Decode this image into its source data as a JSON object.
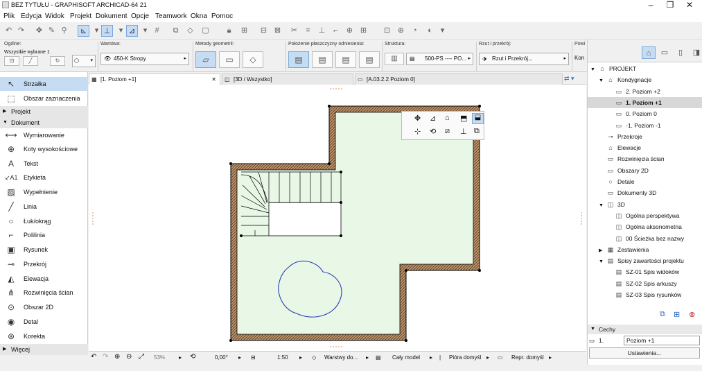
{
  "window": {
    "title": "BEZ TYTUŁU - GRAPHISOFT ARCHICAD-64 21"
  },
  "menu": [
    "Plik",
    "Edycja",
    "Widok",
    "Projekt",
    "Dokument",
    "Opcje",
    "Teamwork",
    "Okna",
    "Pomoc"
  ],
  "info": {
    "general_label": "Ogólne:",
    "general_value": "Wszystkie wybrane 1",
    "layer_label": "Warstwa:",
    "layer_value": "450-K Stropy",
    "geometry_label": "Metody geometrii:",
    "plane_label": "Położenie płaszczyzny odniesienia:",
    "structure_label": "Struktura:",
    "structure_value": "500-PS ---- PO...",
    "plan_label": "Rzut i przekrój:",
    "plan_value": "Rzut i Przekrój...",
    "extra_label": "Powi",
    "extra_value": "Kon"
  },
  "toolbox": {
    "items_top": [
      {
        "label": "Strzałka",
        "icon": "arrow-icon"
      },
      {
        "label": "Obszar zaznaczenia",
        "icon": "marquee-icon"
      }
    ],
    "section_projekt": "Projekt",
    "section_dokument": "Dokument",
    "items_doc": [
      {
        "label": "Wymiarowanie",
        "icon": "dimension-icon"
      },
      {
        "label": "Koty wysokościowe",
        "icon": "level-icon"
      },
      {
        "label": "Tekst",
        "icon": "text-icon"
      },
      {
        "label": "Etykieta",
        "icon": "label-icon"
      },
      {
        "label": "Wypełnienie",
        "icon": "fill-icon"
      },
      {
        "label": "Linia",
        "icon": "line-icon"
      },
      {
        "label": "Łuk/okrąg",
        "icon": "arc-icon"
      },
      {
        "label": "Polilinia",
        "icon": "polyline-icon"
      },
      {
        "label": "Rysunek",
        "icon": "drawing-icon"
      },
      {
        "label": "Przekrój",
        "icon": "section-icon"
      },
      {
        "label": "Elewacja",
        "icon": "elevation-icon"
      },
      {
        "label": "Rozwinięcia ścian",
        "icon": "interior-elevation-icon"
      },
      {
        "label": "Obszar 2D",
        "icon": "worksheet-icon"
      },
      {
        "label": "Detal",
        "icon": "detail-icon"
      },
      {
        "label": "Korekta",
        "icon": "change-icon"
      }
    ],
    "section_more": "Więcej"
  },
  "tabs": [
    {
      "label": "[1. Poziom +1]"
    },
    {
      "label": "[3D / Wszystko]"
    },
    {
      "label": "[A.03.2.2 Poziom 0]"
    }
  ],
  "status": {
    "zoom": "53%",
    "angle": "0,00°",
    "scale": "1:50",
    "layers": "Warstwy do...",
    "model": "Cały model",
    "pens": "Pióra domyśl",
    "repr": "Repr. domyśl"
  },
  "navigator": {
    "tree": [
      {
        "label": "PROJEKT",
        "level": 0,
        "icon": "project-icon",
        "expanded": true
      },
      {
        "label": "Kondygnacje",
        "level": 1,
        "icon": "stories-icon",
        "expanded": true
      },
      {
        "label": "2. Poziom +2",
        "level": 2,
        "icon": "story-icon"
      },
      {
        "label": "1. Poziom +1",
        "level": 2,
        "icon": "story-icon",
        "selected": true
      },
      {
        "label": "0. Poziom 0",
        "level": 2,
        "icon": "story-icon"
      },
      {
        "label": "-1. Poziom -1",
        "level": 2,
        "icon": "story-icon"
      },
      {
        "label": "Przekroje",
        "level": 1,
        "icon": "section-icon"
      },
      {
        "label": "Elewacje",
        "level": 1,
        "icon": "elevation-icon"
      },
      {
        "label": "Rozwinięcia ścian",
        "level": 1,
        "icon": "interior-icon"
      },
      {
        "label": "Obszary 2D",
        "level": 1,
        "icon": "worksheet-icon"
      },
      {
        "label": "Detale",
        "level": 1,
        "icon": "detail-icon"
      },
      {
        "label": "Dokumenty 3D",
        "level": 1,
        "icon": "doc3d-icon"
      },
      {
        "label": "3D",
        "level": 1,
        "icon": "cube-icon",
        "expanded": true
      },
      {
        "label": "Ogólna perspektywa",
        "level": 2,
        "icon": "perspective-icon"
      },
      {
        "label": "Ogólna aksonometria",
        "level": 2,
        "icon": "axonometry-icon"
      },
      {
        "label": "00 Ścieżka bez nazwy",
        "level": 2,
        "icon": "path-icon"
      },
      {
        "label": "Zestawienia",
        "level": 1,
        "icon": "schedule-icon",
        "collapsed": true
      },
      {
        "label": "Spisy zawartości projektu",
        "level": 1,
        "icon": "index-icon",
        "expanded": true
      },
      {
        "label": "SZ-01 Spis widoków",
        "level": 2,
        "icon": "list-icon"
      },
      {
        "label": "SZ-02 Spis arkuszy",
        "level": 2,
        "icon": "list-icon"
      },
      {
        "label": "SZ-03 Spis rysunków",
        "level": 2,
        "icon": "list-icon"
      }
    ],
    "props_label": "Cechy",
    "props_id": "1.",
    "props_value": "Poziom +1",
    "settings_button": "Ustawienia..."
  },
  "colors": {
    "slab_fill": "#e8f7e6",
    "wall_fill": "#b8916a",
    "selection": "#7aa8d8",
    "curve": "#2b3fb8"
  }
}
